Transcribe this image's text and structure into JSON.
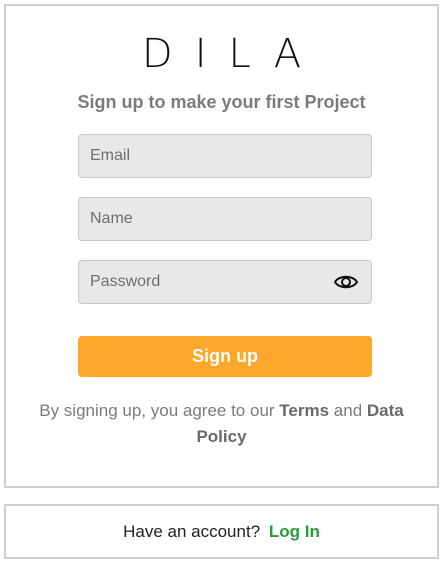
{
  "brand": {
    "name": "DILA"
  },
  "signup": {
    "tagline": "Sign up to make your first Project",
    "email_placeholder": "Email",
    "name_placeholder": "Name",
    "password_placeholder": "Password",
    "password_toggle_icon": "eye-icon",
    "submit_label": "Sign up",
    "terms_prefix": "By signing up, you agree to our",
    "terms_link": "Terms",
    "terms_and": "and",
    "policy_link": "Data Policy"
  },
  "login": {
    "prompt": "Have an account?",
    "link_label": "Log In"
  },
  "colors": {
    "accent": "#fda72b",
    "login_link": "#2e9a3f",
    "field_bg": "#e8e8e8"
  }
}
